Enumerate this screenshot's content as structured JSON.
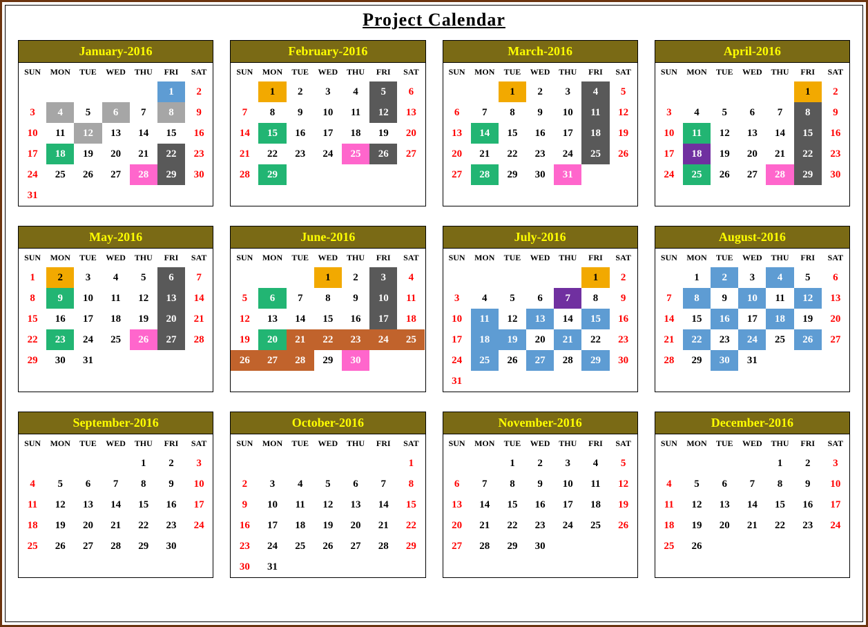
{
  "title": "Project  Calendar",
  "dow": [
    "SUN",
    "MON",
    "TUE",
    "WED",
    "THU",
    "FRI",
    "SAT"
  ],
  "colors": {
    "blue": "#5e9cd3",
    "gray": "#a6a6a6",
    "green": "#22b573",
    "dark": "#595959",
    "pink": "#ff66cc",
    "orange": "#f2a900",
    "brown": "#c1632c",
    "purple": "#7030a0"
  },
  "months": [
    {
      "name": "January-2016",
      "start": 5,
      "days": 31,
      "hl": {
        "1": "blue",
        "4": "gray",
        "6": "gray",
        "8": "gray",
        "12": "gray",
        "18": "green",
        "22": "dark",
        "28": "pink",
        "29": "dark"
      }
    },
    {
      "name": "February-2016",
      "start": 1,
      "days": 29,
      "hl": {
        "1": "orange",
        "5": "dark",
        "12": "dark",
        "15": "green",
        "25": "pink",
        "26": "dark",
        "29": "green"
      }
    },
    {
      "name": "March-2016",
      "start": 2,
      "days": 31,
      "hl": {
        "1": "orange",
        "4": "dark",
        "11": "dark",
        "14": "green",
        "18": "dark",
        "25": "dark",
        "28": "green",
        "31": "pink"
      }
    },
    {
      "name": "April-2016",
      "start": 5,
      "days": 30,
      "hl": {
        "1": "orange",
        "8": "dark",
        "11": "green",
        "15": "dark",
        "18": "purple",
        "22": "dark",
        "25": "green",
        "28": "pink",
        "29": "dark"
      }
    },
    {
      "name": "May-2016",
      "start": 0,
      "days": 31,
      "hl": {
        "2": "orange",
        "6": "dark",
        "9": "green",
        "13": "dark",
        "20": "dark",
        "23": "green",
        "26": "pink",
        "27": "dark"
      }
    },
    {
      "name": "June-2016",
      "start": 3,
      "days": 30,
      "hl": {
        "1": "orange",
        "3": "dark",
        "6": "green",
        "10": "dark",
        "17": "dark",
        "20": "green",
        "21": "brown",
        "22": "brown",
        "23": "brown",
        "24": "brown",
        "25": "brown",
        "26": "brown",
        "27": "brown",
        "28": "brown",
        "30": "pink"
      }
    },
    {
      "name": "July-2016",
      "start": 5,
      "days": 31,
      "hl": {
        "1": "orange",
        "7": "purple",
        "11": "blue",
        "13": "blue",
        "15": "blue",
        "18": "blue",
        "19": "blue",
        "21": "blue",
        "25": "blue",
        "27": "blue",
        "29": "blue"
      }
    },
    {
      "name": "August-2016",
      "start": 1,
      "days": 31,
      "hl": {
        "2": "blue",
        "4": "blue",
        "8": "blue",
        "10": "blue",
        "12": "blue",
        "16": "blue",
        "18": "blue",
        "22": "blue",
        "24": "blue",
        "26": "blue",
        "30": "blue"
      }
    },
    {
      "name": "September-2016",
      "start": 4,
      "days": 30,
      "hl": {}
    },
    {
      "name": "October-2016",
      "start": 6,
      "days": 31,
      "hl": {}
    },
    {
      "name": "November-2016",
      "start": 2,
      "days": 30,
      "hl": {}
    },
    {
      "name": "December-2016",
      "start": 4,
      "days": 26,
      "hl": {}
    }
  ]
}
